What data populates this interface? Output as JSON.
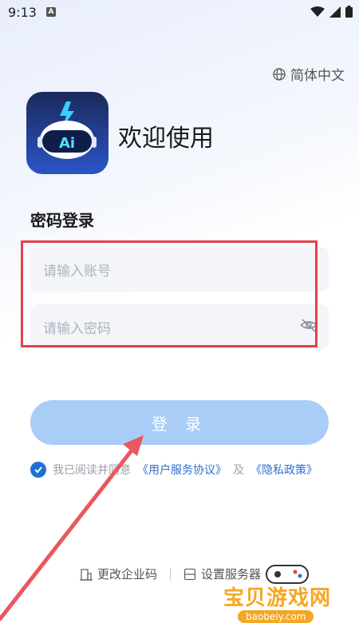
{
  "status_bar": {
    "time": "9:13",
    "notification_letter": "A"
  },
  "language": {
    "label": "简体中文",
    "icon": "globe-icon"
  },
  "header": {
    "title": "欢迎使用"
  },
  "logo": {
    "text": "Ai",
    "icon": "robot-logo-icon"
  },
  "login": {
    "section_title": "密码登录",
    "account_placeholder": "请输入账号",
    "password_placeholder": "请输入密码",
    "submit_label": "登 录"
  },
  "agreement": {
    "prefix": "我已阅读并同意",
    "user_agreement": "《用户服务协议》",
    "and": "及",
    "privacy_policy": "《隐私政策》",
    "checked": true
  },
  "footer": {
    "change_company_code": "更改企业码",
    "set_server": "设置服务器"
  },
  "watermark": {
    "name": "宝贝游戏网",
    "url": "baobeiy.com"
  },
  "colors": {
    "primary": "#1e6fd9",
    "button_disabled": "#a9cdf6",
    "annotation_red": "#e5414b",
    "link": "#2f6fd0"
  }
}
